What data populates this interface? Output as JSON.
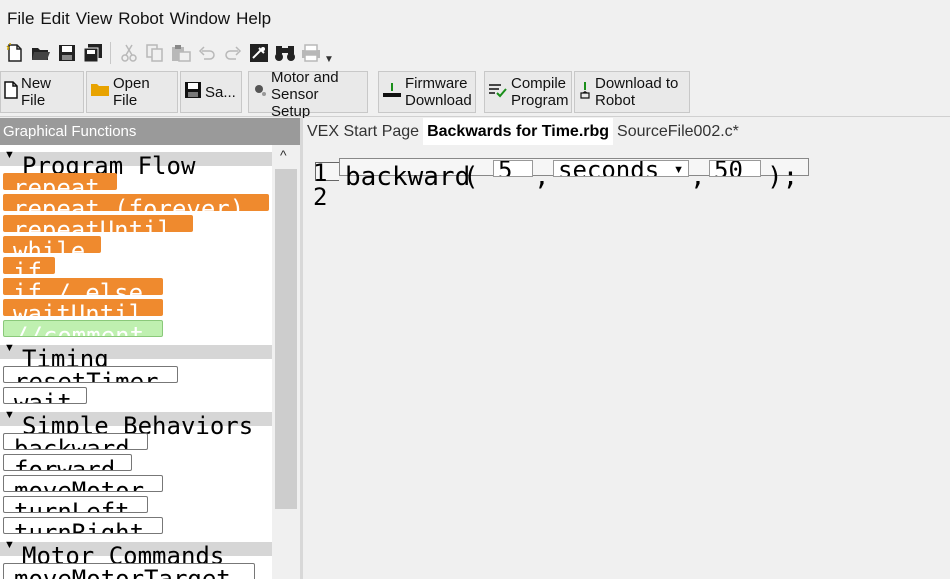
{
  "menu": [
    "File",
    "Edit",
    "View",
    "Robot",
    "Window",
    "Help"
  ],
  "icons": {
    "new": "new-document-icon",
    "open": "open-folder-icon",
    "save": "save-icon",
    "save_all": "save-all-icon",
    "cut": "cut-icon",
    "copy": "copy-icon",
    "paste": "paste-icon",
    "undo": "undo-icon",
    "redo": "redo-icon",
    "debug": "debugger-icon",
    "find": "binoculars-icon",
    "print": "print-icon",
    "more": "overflow-chevron-icon"
  },
  "toolbar": {
    "new_file": [
      "New",
      "File"
    ],
    "open_file": [
      "Open",
      "File"
    ],
    "save": "Sa...",
    "motor_sensor": [
      "Motor and",
      "Sensor",
      "Setup"
    ],
    "firmware": [
      "Firmware",
      "Download"
    ],
    "compile": [
      "Compile",
      "Program"
    ],
    "download": [
      "Download to",
      "Robot"
    ]
  },
  "panel": {
    "title": "Graphical Functions",
    "categories": [
      {
        "label": "Program Flow",
        "blocks": [
          "repeat",
          "repeat (forever)",
          "repeatUntil",
          "while",
          "if",
          "if / else",
          "waitUntil",
          "//comment"
        ]
      },
      {
        "label": "Timing",
        "blocks": [
          "resetTimer",
          "wait"
        ]
      },
      {
        "label": "Simple Behaviors",
        "blocks": [
          "backward",
          "forward",
          "moveMotor",
          "turnLeft",
          "turnRight"
        ]
      },
      {
        "label": "Motor Commands",
        "blocks": [
          "moveMotorTarget"
        ]
      }
    ]
  },
  "tabs": [
    "VEX Start Page",
    "Backwards for Time.rbg",
    "SourceFile002.c*"
  ],
  "active_tab_index": 1,
  "editor": {
    "line_numbers": [
      "1",
      "2"
    ],
    "statement": {
      "func": "backward",
      "open": "(",
      "comma": ",",
      "close": ");",
      "arg1": "5",
      "unit": "seconds",
      "arg2": "50"
    }
  },
  "colors": {
    "flow_block": "#ef8a2e",
    "comment_block": "#bff0b0",
    "panel_header": "#9a9a9a"
  }
}
